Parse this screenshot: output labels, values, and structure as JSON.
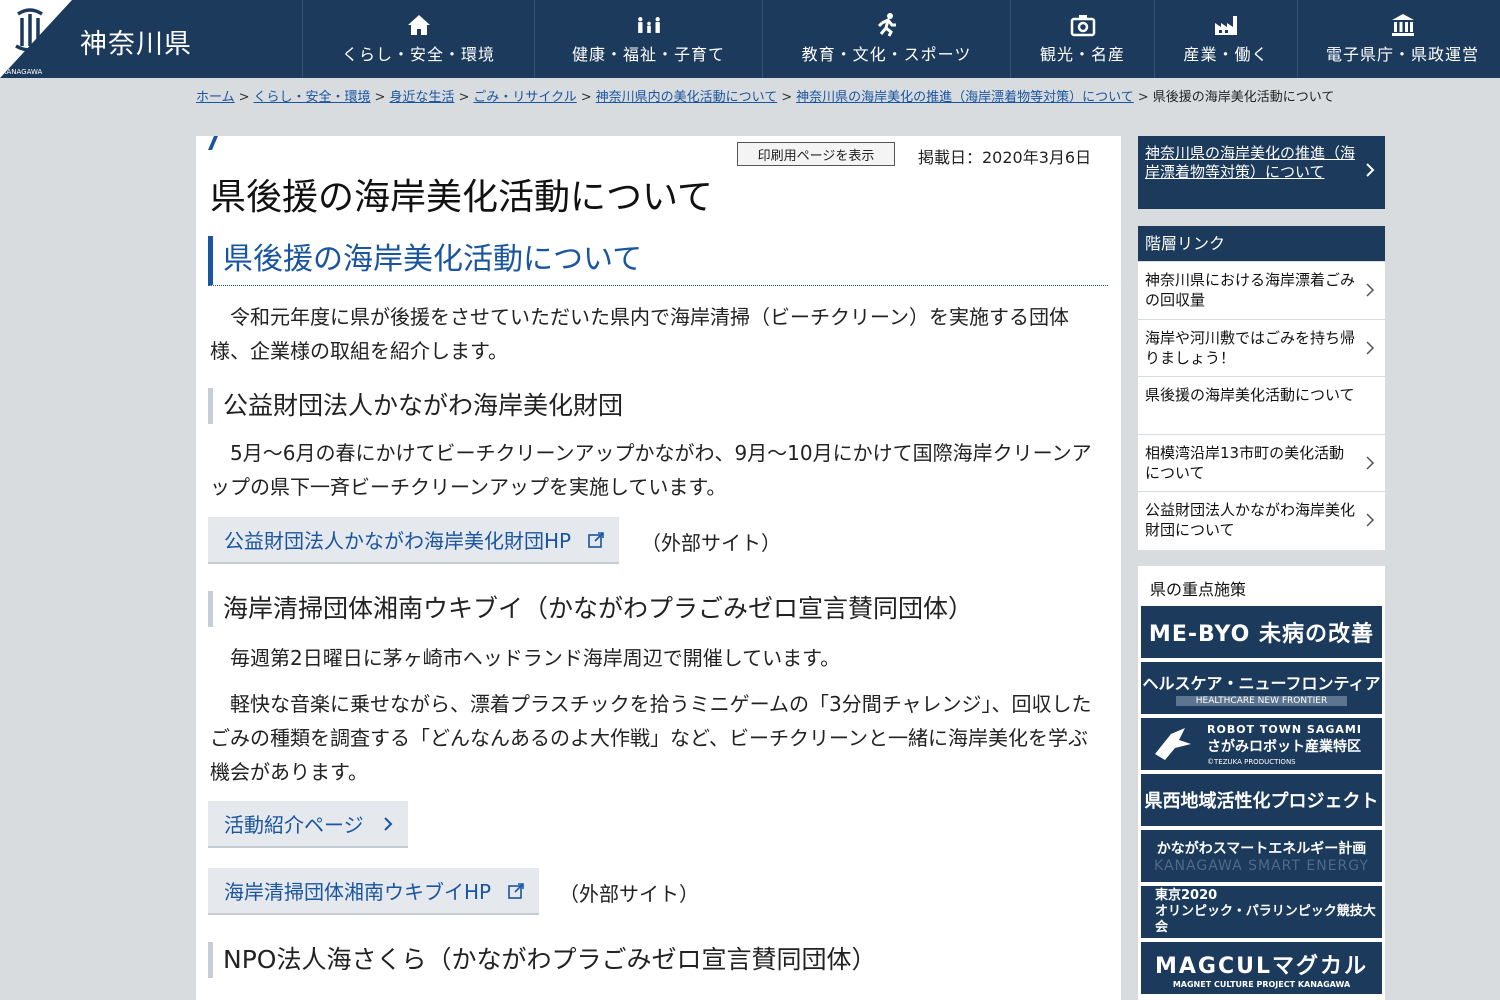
{
  "header": {
    "logo_text": "神奈川県",
    "logo_small": "KANAGAWA",
    "nav": [
      {
        "label": "くらし・安全・環境",
        "icon": "home-icon"
      },
      {
        "label": "健康・福祉・子育て",
        "icon": "family-icon"
      },
      {
        "label": "教育・文化・スポーツ",
        "icon": "runner-icon"
      },
      {
        "label": "観光・名産",
        "icon": "camera-icon"
      },
      {
        "label": "産業・働く",
        "icon": "factory-icon"
      },
      {
        "label": "電子県庁・県政運営",
        "icon": "government-building-icon"
      }
    ]
  },
  "breadcrumb": {
    "links": [
      "ホーム",
      "くらし・安全・環境",
      "身近な生活",
      "ごみ・リサイクル",
      "神奈川県内の美化活動について",
      "神奈川県の海岸美化の推進（海岸漂着物等対策）について"
    ],
    "current": "県後援の海岸美化活動について",
    "separator": ">"
  },
  "main": {
    "print_button": "印刷用ページを表示",
    "published": "掲載日：2020年3月6日",
    "title": "県後援の海岸美化活動について",
    "h2": "県後援の海岸美化活動について",
    "intro": "令和元年度に県が後援をさせていただいた県内で海岸清掃（ビーチクリーン）を実施する団体様、企業様の取組を紹介します。",
    "section1": {
      "heading": "公益財団法人かながわ海岸美化財団",
      "text": "5月～6月の春にかけてビーチクリーンアップかながわ、9月～10月にかけて国際海岸クリーンアップの県下一斉ビーチクリーンアップを実施しています。",
      "link": "公益財団法人かながわ海岸美化財団HP",
      "note": "（外部サイト）"
    },
    "section2": {
      "heading": "海岸清掃団体湘南ウキブイ（かながわプラごみゼロ宣言賛同団体）",
      "text1": "毎週第2日曜日に茅ヶ崎市ヘッドランド海岸周辺で開催しています。",
      "text2": "軽快な音楽に乗せながら、漂着プラスチックを拾うミニゲームの「3分間チャレンジ」、回収したごみの種類を調査する「どんなんあるのよ大作戦」など、ビーチクリーンと一緒に海岸美化を学ぶ機会があります。",
      "link_page": "活動紹介ページ",
      "link_hp": "海岸清掃団体湘南ウキブイHP",
      "note": "（外部サイト）"
    },
    "section3": {
      "heading": "NPO法人海さくら（かながわプラごみゼロ宣言賛同団体）"
    }
  },
  "sidebar": {
    "parent_link": "神奈川県の海岸美化の推進（海岸漂着物等対策）について",
    "tier_heading": "階層リンク",
    "tier_items": [
      "神奈川県における海岸漂着ごみの回収量",
      "海岸や河川敷ではごみを持ち帰りましょう！",
      "県後援の海岸美化活動について",
      "相模湾沿岸13市町の美化活動について",
      "公益財団法人かながわ海岸美化財団について"
    ],
    "focus_title": "県の重点施策",
    "banners": {
      "b1": "ME-BYO 未病の改善",
      "b2_main": "ヘルスケア・ニューフロンティア",
      "b2_sub": "HEALTHCARE NEW FRONTIER",
      "b3_en": "ROBOT TOWN SAGAMI",
      "b3_ja": "さがみロボット産業特区",
      "b3_credit": "©TEZUKA PRODUCTIONS",
      "b4": "県西地域活性化プロジェクト",
      "b5_main": "かながわスマートエネルギー計画",
      "b5_sub": "KANAGAWA SMART ENERGY",
      "b6_line1": "東京2020",
      "b6_line2": "オリンピック・パラリンピック競技大会",
      "b7_main": "MAGCULマグカル",
      "b7_sub": "MAGNET CULTURE PROJECT KANAGAWA"
    }
  },
  "colors": {
    "header_bg": "#1b3a5c",
    "link": "#1a55a0",
    "page_bg": "#d9dcdf"
  }
}
